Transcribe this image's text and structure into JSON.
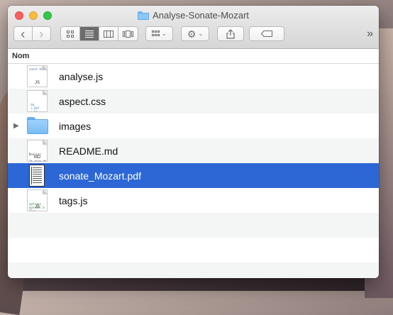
{
  "window": {
    "title": "Analyse-Sonate-Mozart"
  },
  "toolbar": {
    "back": "‹",
    "forward": "›",
    "more": "»"
  },
  "list_header": {
    "name_column": "Nom"
  },
  "files": [
    {
      "name": "analyse.js",
      "kind": "js",
      "icon_text": "const AI",
      "ext": "JS"
    },
    {
      "name": "aspect.css",
      "kind": "css",
      "icon_text": ".ba\n s.Def\n s.Do\n #\nsectionIt",
      "ext": ""
    },
    {
      "name": "images",
      "kind": "folder"
    },
    {
      "name": "README.md",
      "kind": "md",
      "icon_text": "Dossier\n\nIt.dozt.dt",
      "ext": "MD"
    },
    {
      "name": "sonate_Mozart.pdf",
      "kind": "pdf",
      "selected": true
    },
    {
      "name": "tags.js",
      "kind": "js",
      "icon_text": "options\noption('a\nTags =\nsco js",
      "ext": "JS"
    }
  ],
  "colors": {
    "selection": "#2d67d6",
    "folder": "#8cc7f8"
  }
}
